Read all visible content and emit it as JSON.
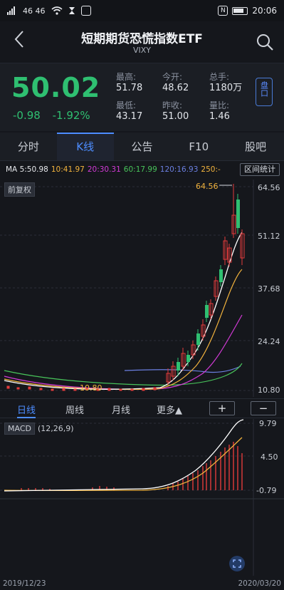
{
  "status_bar": {
    "left_icons": [
      "signal-icon",
      "wifi-icon",
      "alarm-icon",
      "app-icon"
    ],
    "signal_text": "46 46",
    "time": "20:06"
  },
  "header": {
    "title": "短期期货恐慌指数ETF",
    "code": "VIXY"
  },
  "quote": {
    "price": "50.02",
    "change": "-0.98",
    "change_pct": "-1.92%",
    "stats": [
      {
        "label": "最高:",
        "value": "51.78"
      },
      {
        "label": "今开:",
        "value": "48.62"
      },
      {
        "label": "总手:",
        "value": "1180万"
      },
      {
        "label": "最低:",
        "value": "43.17"
      },
      {
        "label": "昨收:",
        "value": "51.00"
      },
      {
        "label": "量比:",
        "value": "1.46"
      }
    ],
    "pankou": "盘口"
  },
  "tabs": [
    "分时",
    "K线",
    "公告",
    "F10",
    "股吧"
  ],
  "active_tab": "K线",
  "ma": {
    "ma5": "MA 5:50.98",
    "ma10": "10:41.97",
    "ma20": "20:30.31",
    "ma60": "60:17.99",
    "ma120": "120:16.93",
    "ma250": "250:-",
    "range_stat": "区间统计"
  },
  "colors": {
    "up": "#e23b3b",
    "down": "#2fbf71",
    "ma5": "#ffffff",
    "ma10": "#f2b33d",
    "ma20": "#d23ad6",
    "ma60": "#48c35a",
    "ma120": "#6b7fe0",
    "accent": "#4d8dff"
  },
  "kchart": {
    "fuquan_label": "前复权",
    "y_ticks": [
      "64.56",
      "51.12",
      "37.68",
      "24.24",
      "10.80"
    ],
    "high_label": "64.56",
    "low_label": "10.80"
  },
  "periods": {
    "items": [
      "日线",
      "周线",
      "月线",
      "更多▲"
    ],
    "active": "日线",
    "zoom_in": "+",
    "zoom_out": "−"
  },
  "macd": {
    "label": "MACD",
    "params": "(12,26,9)",
    "y_ticks": [
      "9.79",
      "4.50",
      "-0.79"
    ]
  },
  "dates": {
    "start": "2019/12/23",
    "end": "2020/03/20"
  }
}
